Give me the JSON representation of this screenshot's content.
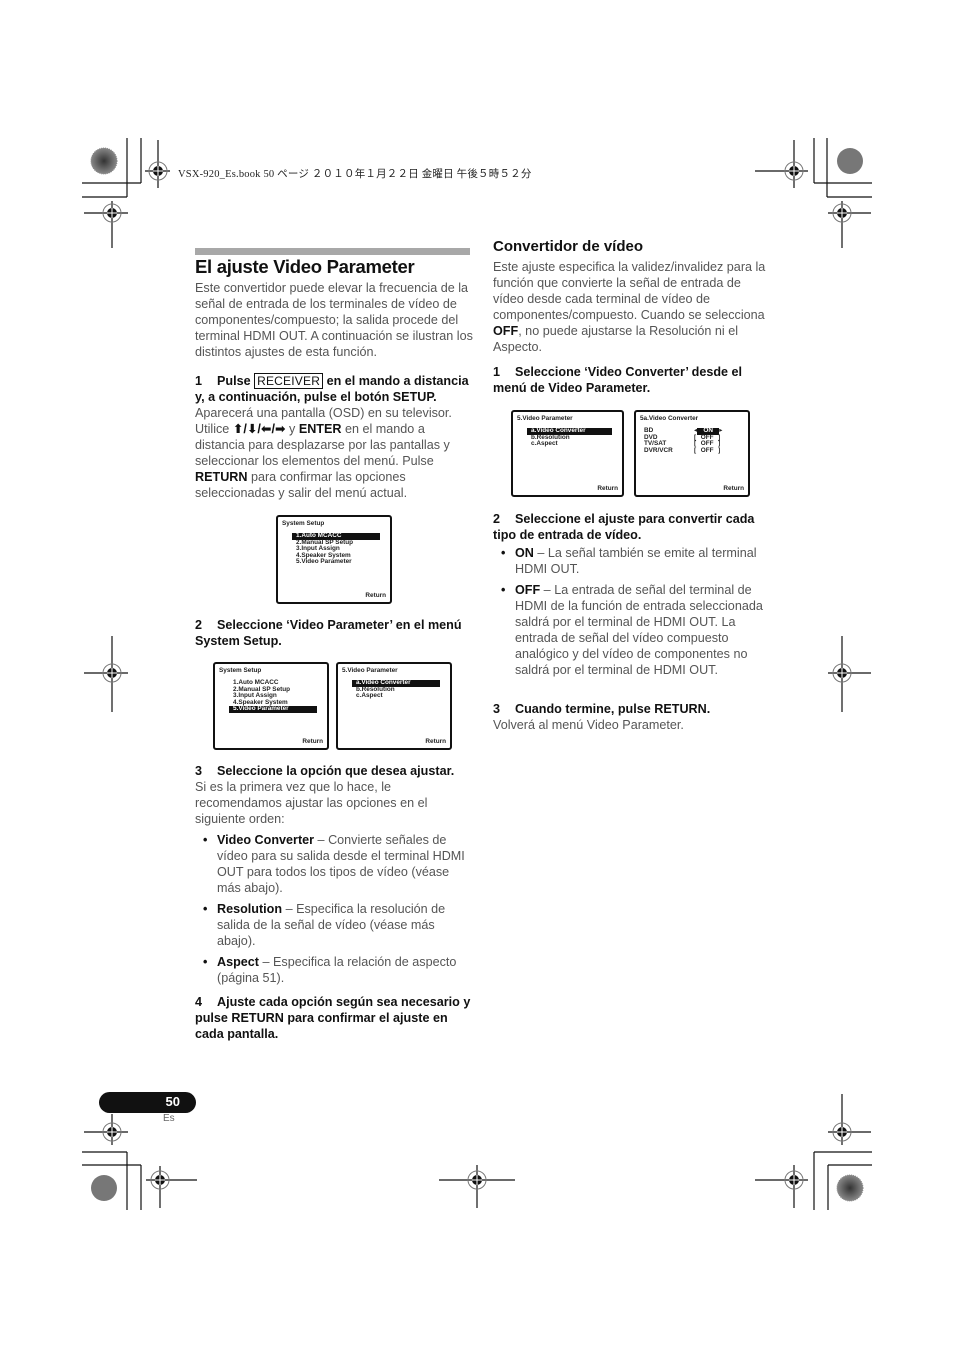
{
  "header": {
    "print_info": "VSX-920_Es.book   50 ページ   ２０１０年１月２２日   金曜日   午後５時５２分"
  },
  "left": {
    "title": "El ajuste Video Parameter",
    "intro": "Este convertidor puede elevar la frecuencia de la señal de entrada de los terminales de vídeo de componentes/compuesto; la salida procede del terminal HDMI OUT. A continuación se ilustran los distintos ajustes de esta función.",
    "step1": {
      "num": "1",
      "pre": "Pulse",
      "key": "RECEIVER",
      "post": "en el mando a distancia y, a continuación, pulse el botón SETUP.",
      "body_a": "Aparecerá una pantalla (OSD) en su televisor. Utilice",
      "arrows": "⬆/⬇/⬅/➡",
      "body_b": "y",
      "enter": "ENTER",
      "body_c": "en el mando a distancia para desplazarse por las pantallas y seleccionar los elementos del menú. Pulse",
      "return": "RETURN",
      "body_d": "para confirmar las opciones seleccionadas y salir del menú actual."
    },
    "step2": {
      "num": "2",
      "text": "Seleccione ‘Video Parameter’ en el menú System Setup."
    },
    "step3": {
      "num": "3",
      "text": "Seleccione la opción que desea ajustar.",
      "body": "Si es la primera vez que lo hace, le recomendamos ajustar las opciones en el siguiente orden:",
      "bullets": [
        {
          "term": "Video Converter",
          "desc": " – Convierte señales de vídeo para su salida desde el terminal HDMI OUT para todos los tipos de vídeo (véase más abajo)."
        },
        {
          "term": "Resolution",
          "desc": " – Especifica la resolución de salida de la señal de vídeo (véase más abajo)."
        },
        {
          "term": "Aspect",
          "desc": " – Especifica la relación de aspecto (página 51)."
        }
      ]
    },
    "step4": {
      "num": "4",
      "text": "Ajuste cada opción según sea necesario y pulse RETURN para confirmar el ajuste en cada pantalla."
    }
  },
  "right": {
    "title": "Convertidor de vídeo",
    "intro_a": "Este ajuste especifica la validez/invalidez para la función que convierte la señal de entrada de vídeo desde cada terminal de vídeo de componentes/compuesto. Cuando se selecciona",
    "intro_off": "OFF",
    "intro_b": ", no puede ajustarse la Resolución ni el Aspecto.",
    "step1": {
      "num": "1",
      "text": "Seleccione ‘Video Converter’ desde el menú de Video Parameter."
    },
    "step2": {
      "num": "2",
      "text": "Seleccione el ajuste para convertir cada tipo de entrada de vídeo.",
      "bullets": [
        {
          "term": "ON",
          "desc": " – La señal también se emite al terminal HDMI OUT."
        },
        {
          "term": "OFF",
          "desc": " – La entrada de señal del terminal de HDMI de la función de entrada seleccionada saldrá por el terminal de HDMI OUT. La entrada de señal del vídeo compuesto analógico y del vídeo de componentes no saldrá por el terminal de HDMI OUT."
        }
      ]
    },
    "step3": {
      "num": "3",
      "text": "Cuando termine, pulse RETURN.",
      "body": "Volverá al menú Video Parameter."
    }
  },
  "osd": {
    "system_setup": {
      "title": "System  Setup",
      "items": [
        "1.Auto  MCACC",
        "2.Manual  SP  Setup",
        "3.Input  Assign",
        "4.Speaker System",
        "5.Video Parameter"
      ],
      "return": "Return"
    },
    "video_parameter": {
      "title": "5.Video Parameter",
      "items": [
        "a.Video Converter",
        "b.Resolution",
        "c.Aspect"
      ],
      "return": "Return"
    },
    "video_converter": {
      "title": "5a.Video Converter",
      "rows": [
        {
          "label": "BD",
          "value": "ON"
        },
        {
          "label": "DVD",
          "value": "OFF"
        },
        {
          "label": "TV/SAT",
          "value": "OFF"
        },
        {
          "label": "DVR/VCR",
          "value": "OFF"
        }
      ],
      "return": "Return"
    }
  },
  "footer": {
    "page_number": "50",
    "language": "Es"
  }
}
